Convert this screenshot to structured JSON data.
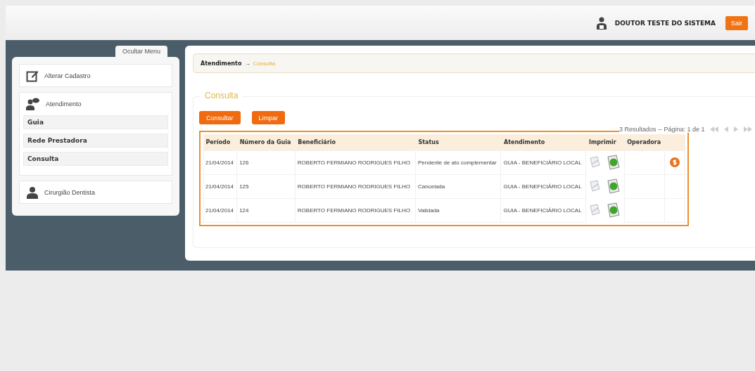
{
  "header": {
    "user_name": "DOUTOR TESTE DO SISTEMA",
    "logout_button": "Sair"
  },
  "sidebar": {
    "toggle": "Ocultar Menu",
    "items": [
      {
        "label": "Alterar Cadastro",
        "kind": "edit"
      },
      {
        "label": "Atendimento",
        "kind": "chat",
        "children": [
          {
            "label": "Guia"
          },
          {
            "label": "Rede Prestadora"
          },
          {
            "label": "Consulta"
          }
        ]
      },
      {
        "label": "Cirurgião Dentista",
        "kind": "person"
      }
    ]
  },
  "breadcrumb": {
    "parent": "Atendimento",
    "separator": "→",
    "current": "Consulta"
  },
  "form": {
    "legend": "Consulta",
    "buttons": [
      "Consultar",
      "Limpar"
    ]
  },
  "pagination": {
    "summary": "3 Resultados -- Página: 1 de 1"
  },
  "table": {
    "columns": [
      "Período",
      "Número da Guia",
      "Beneficiário",
      "Status",
      "Atendimento",
      "Imprimir",
      "Operadora"
    ],
    "rows": [
      {
        "periodo": "21/04/2014",
        "numero": "126",
        "beneficiario": "ROBERTO FERMIANO RODRIGUES FILHO",
        "status": "Pendente de ato complementar",
        "atendimento": "GUIA - BENEFICIÁRIO LOCAL",
        "payment": true
      },
      {
        "periodo": "21/04/2014",
        "numero": "125",
        "beneficiario": "ROBERTO FERMIANO RODRIGUES FILHO",
        "status": "Cancelada",
        "atendimento": "GUIA - BENEFICIÁRIO LOCAL",
        "payment": false
      },
      {
        "periodo": "21/04/2014",
        "numero": "124",
        "beneficiario": "ROBERTO FERMIANO RODRIGUES FILHO",
        "status": "Validada",
        "atendimento": "GUIA - BENEFICIÁRIO LOCAL",
        "payment": false
      }
    ]
  }
}
